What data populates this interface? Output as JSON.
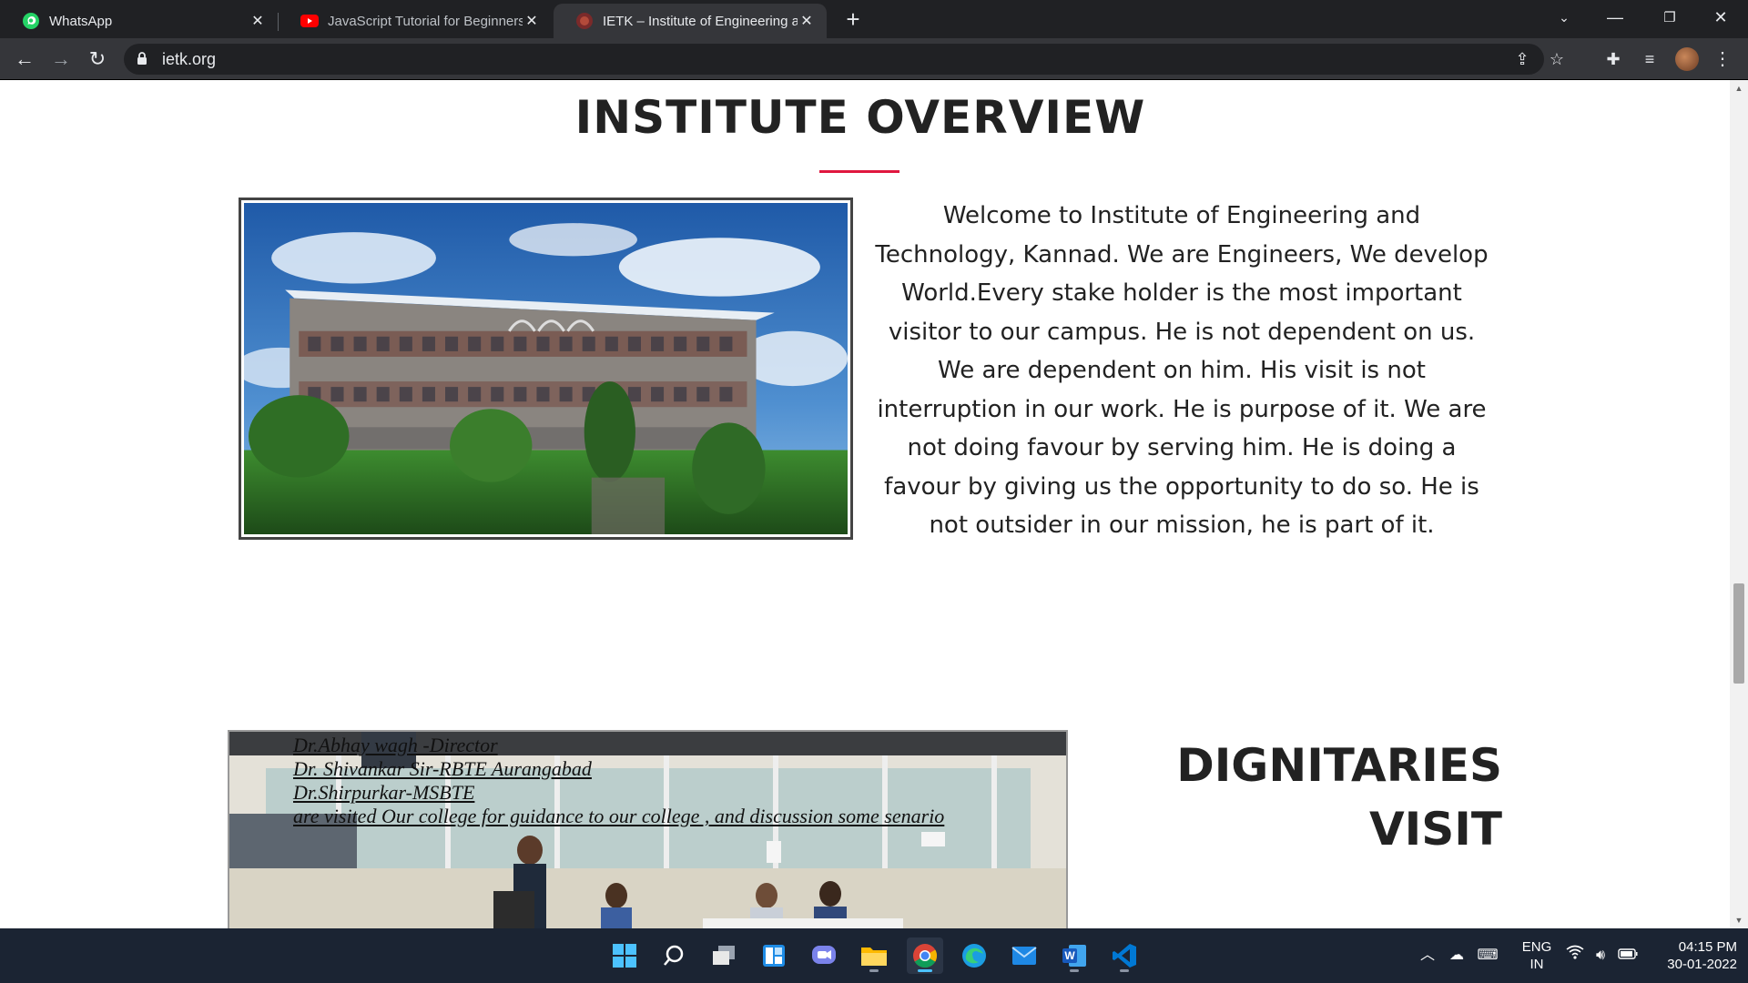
{
  "browser": {
    "tabs": [
      {
        "title": "WhatsApp",
        "active": false
      },
      {
        "title": "JavaScript Tutorial for Beginners: ",
        "active": false
      },
      {
        "title": "IETK – Institute of Engineering an",
        "active": true
      }
    ],
    "url": "ietk.org"
  },
  "page": {
    "overview_title": "INSTITUTE OVERVIEW",
    "welcome_text": "Welcome to Institute of Engineering and Technology, Kannad. We are Engineers, We develop World.Every stake holder is the most important visitor to our campus. He is not dependent on us. We are dependent on him. His visit is not interruption in our work. He is purpose of it. We are not doing favour by serving him. He is doing a favour by giving us the opportunity to do so. He is not outsider in our mission, he is part of it.",
    "visit_caption": [
      "Dr.Abhay wagh -Director",
      "Dr. Shivankar Sir-RBTE Aurangabad",
      "Dr.Shirpurkar-MSBTE",
      "are visited Our college for guidance to our college , and discussion some senario"
    ],
    "dignitaries_title_line1": "DIGNITARIES",
    "dignitaries_title_line2": "VISIT",
    "accent_color": "#e0173f"
  },
  "taskbar": {
    "apps": [
      "start",
      "search",
      "task-view",
      "widgets",
      "chat",
      "file-explorer",
      "chrome",
      "edge",
      "mail",
      "word",
      "vscode"
    ],
    "language": {
      "line1": "ENG",
      "line2": "IN"
    },
    "time": "04:15 PM",
    "date": "30-01-2022"
  }
}
